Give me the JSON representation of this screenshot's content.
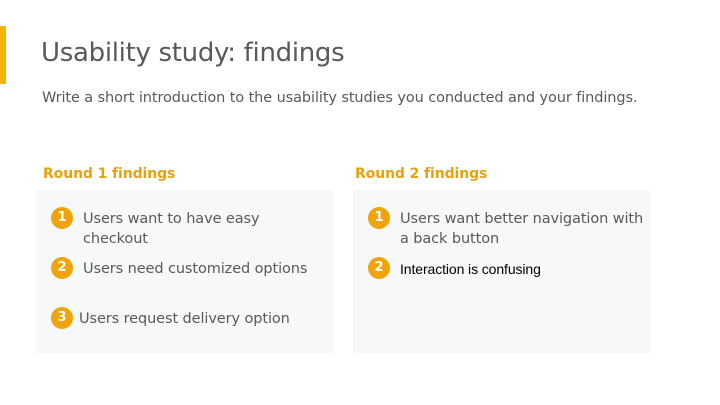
{
  "slide": {
    "title": "Usability study: findings",
    "subtitle": "Write a short introduction to the usability studies you conducted and your findings.",
    "accent_color": "#f4b400"
  },
  "round1": {
    "heading": "Round 1 findings",
    "findings": [
      {
        "number": "1",
        "text": "Users want to have easy checkout"
      },
      {
        "number": "2",
        "text": "Users need customized options"
      },
      {
        "number": "3",
        "text": "Users request delivery option"
      }
    ]
  },
  "round2": {
    "heading": "Round 2 findings",
    "findings": [
      {
        "number": "1",
        "text": "Users want better navigation with a back button"
      },
      {
        "number": "2",
        "text": "Interaction is confusing"
      }
    ]
  },
  "colors": {
    "heading": "#e8a20c",
    "badge": "#f0a30a",
    "panel_bg": "#f7f8fa",
    "text": "#595959"
  }
}
